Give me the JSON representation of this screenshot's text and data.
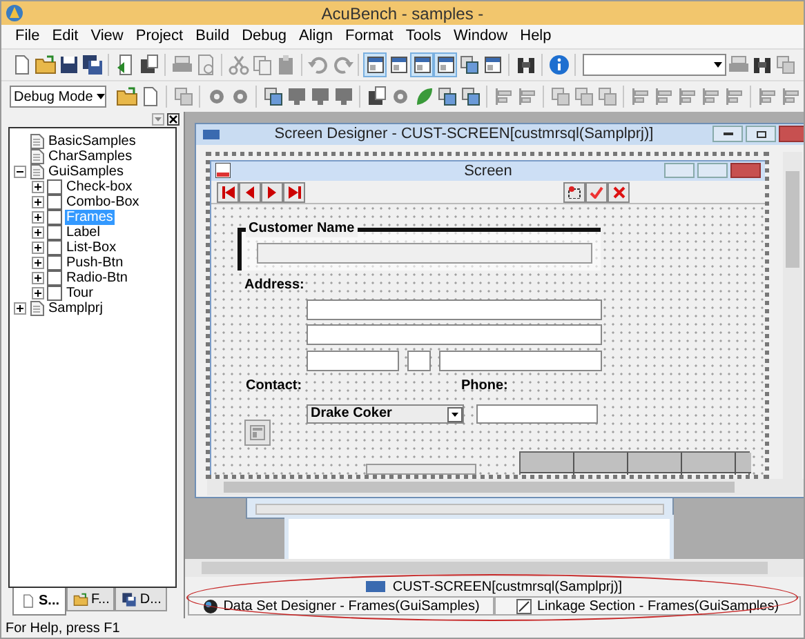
{
  "window": {
    "title": "AcuBench - samples -"
  },
  "menu": [
    "File",
    "Edit",
    "View",
    "Project",
    "Build",
    "Debug",
    "Align",
    "Format",
    "Tools",
    "Window",
    "Help"
  ],
  "toolbar": {
    "layout_buttons": [
      {
        "pressed": true
      },
      {
        "pressed": false
      },
      {
        "pressed": true
      },
      {
        "pressed": true
      }
    ]
  },
  "mode_selector": {
    "value": "Debug Mode"
  },
  "project_tree": [
    {
      "label": "BasicSamples",
      "kind": "file",
      "selected": false
    },
    {
      "label": "CharSamples",
      "kind": "file",
      "selected": false
    },
    {
      "label": "GuiSamples",
      "kind": "folder",
      "expanded": true,
      "selected": false,
      "children": [
        {
          "label": "Check-box",
          "kind": "form",
          "expanded": false,
          "selected": false
        },
        {
          "label": "Combo-Box",
          "kind": "form",
          "expanded": false,
          "selected": false
        },
        {
          "label": "Frames",
          "kind": "form",
          "expanded": false,
          "selected": true
        },
        {
          "label": "Label",
          "kind": "form",
          "expanded": false,
          "selected": false
        },
        {
          "label": "List-Box",
          "kind": "form",
          "expanded": false,
          "selected": false
        },
        {
          "label": "Push-Btn",
          "kind": "form",
          "expanded": false,
          "selected": false
        },
        {
          "label": "Radio-Btn",
          "kind": "form",
          "expanded": false,
          "selected": false
        },
        {
          "label": "Tour",
          "kind": "form",
          "expanded": false,
          "selected": false
        }
      ]
    },
    {
      "label": "Samplprj",
      "kind": "folder",
      "expanded": false,
      "selected": false
    }
  ],
  "panel_tabs": [
    {
      "label": "S...",
      "selected": true
    },
    {
      "label": "F...",
      "selected": false
    },
    {
      "label": "D...",
      "selected": false
    }
  ],
  "designer": {
    "title": "Screen Designer - CUST-SCREEN[custmrsql(Samplprj)]",
    "screen": {
      "title": "Screen",
      "frame_title": "Customer Name",
      "address_label": "Address:",
      "contact_label": "Contact:",
      "phone_label": "Phone:",
      "contact_value": "Drake Coker"
    }
  },
  "document_tabs": [
    {
      "label": "CUST-SCREEN[custmrsql(Samplprj)]"
    }
  ],
  "window_tabs": [
    {
      "label": "Data Set Designer - Frames(GuiSamples)"
    },
    {
      "label": "Linkage Section - Frames(GuiSamples)"
    }
  ],
  "status_bar": "For Help, press F1"
}
